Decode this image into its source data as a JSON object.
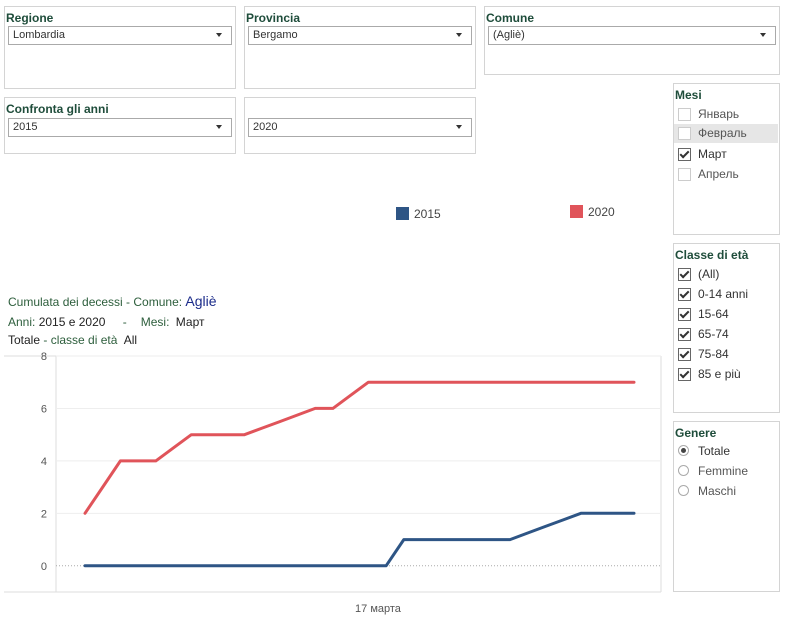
{
  "filters": {
    "regione": {
      "label": "Regione",
      "value": "Lombardia"
    },
    "provincia": {
      "label": "Provincia",
      "value": "Bergamo"
    },
    "comune": {
      "label": "Comune",
      "value": "(Agliè)"
    },
    "anni": {
      "label": "Confronta gli anni",
      "value_a": "2015",
      "value_b": "2020"
    }
  },
  "mesi": {
    "title": "Mesi",
    "options": [
      {
        "label": "Январь",
        "checked": false
      },
      {
        "label": "Февраль",
        "checked": false
      },
      {
        "label": "Март",
        "checked": true
      },
      {
        "label": "Апрель",
        "checked": false
      }
    ]
  },
  "classe_eta": {
    "title": "Classe di età",
    "options": [
      {
        "label": "(All)",
        "checked": true
      },
      {
        "label": "0-14 anni",
        "checked": true
      },
      {
        "label": "15-64",
        "checked": true
      },
      {
        "label": "65-74",
        "checked": true
      },
      {
        "label": "75-84",
        "checked": true
      },
      {
        "label": "85 e più",
        "checked": true
      }
    ]
  },
  "genere": {
    "title": "Genere",
    "options": [
      {
        "label": "Totale",
        "selected": true
      },
      {
        "label": "Femmine",
        "selected": false
      },
      {
        "label": "Maschi",
        "selected": false
      }
    ]
  },
  "legend": [
    {
      "label": "2015",
      "color": "#2e5585"
    },
    {
      "label": "2020",
      "color": "#e0545a"
    }
  ],
  "caption": {
    "line1_prefix": "Cumulata dei decessi -  Comune: ",
    "line1_comune": "Agliè",
    "line2_anni_label": "Anni: ",
    "line2_anni_value": "2015 e 2020",
    "line2_sep": "-",
    "line2_mesi_label": "Mesi:",
    "line2_mesi_value": "Март",
    "line3_totale": "Totale",
    "line3_dash": " - ",
    "line3_classe_label": "classe di età",
    "line3_classe_value": "All"
  },
  "chart_data": {
    "type": "line",
    "xlabel": "17 марта",
    "ylim": [
      -1,
      8
    ],
    "yticks": [
      0,
      2,
      4,
      6,
      8
    ],
    "x": [
      0,
      1,
      2,
      3,
      4,
      5,
      6,
      7,
      8,
      9,
      10,
      11,
      12,
      13,
      14,
      15,
      16,
      17,
      18,
      19,
      20,
      21,
      22,
      23,
      24,
      25,
      26,
      27,
      28,
      29,
      30,
      31
    ],
    "series": [
      {
        "name": "2015",
        "color": "#2e5585",
        "values": [
          0,
          0,
          0,
          0,
          0,
          0,
          0,
          0,
          0,
          0,
          0,
          0,
          0,
          0,
          0,
          0,
          0,
          0,
          1,
          1,
          1,
          1,
          1,
          1,
          1,
          1.25,
          1.5,
          1.75,
          2,
          2,
          2,
          2
        ]
      },
      {
        "name": "2020",
        "color": "#e0545a",
        "values": [
          2,
          3,
          4,
          4,
          4,
          4.5,
          5,
          5,
          5,
          5,
          5.25,
          5.5,
          5.75,
          6,
          6,
          6.5,
          7,
          7,
          7,
          7,
          7,
          7,
          7,
          7,
          7,
          7,
          7,
          7,
          7,
          7,
          7,
          7
        ]
      }
    ],
    "grid": true
  }
}
